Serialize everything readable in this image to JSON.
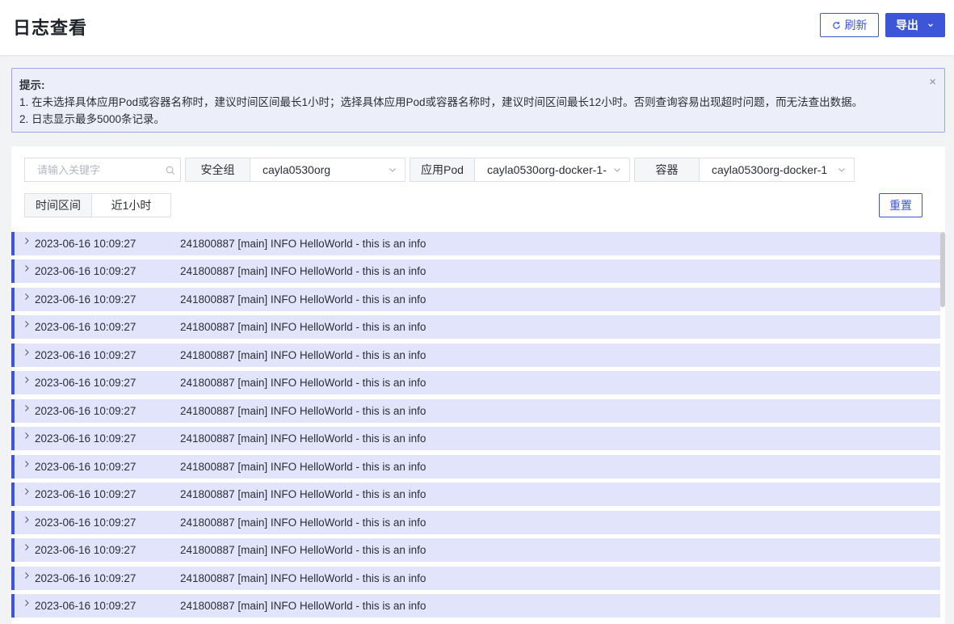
{
  "header": {
    "title": "日志查看",
    "refresh_label": "刷新",
    "export_label": "导出"
  },
  "tip": {
    "title": "提示:",
    "line1": "1. 在未选择具体应用Pod或容器名称时，建议时间区间最长1小时；选择具体应用Pod或容器名称时，建议时间区间最长12小时。否则查询容易出现超时问题，而无法查出数据。",
    "line2": "2. 日志显示最多5000条记录。",
    "close_glyph": "×"
  },
  "filters": {
    "search_placeholder": "请输入关键字",
    "security_group_label": "安全组",
    "security_group_value": "cayla0530org",
    "pod_label": "应用Pod",
    "pod_value": "cayla0530org-docker-1-",
    "container_label": "容器",
    "container_value": "cayla0530org-docker-1",
    "time_label": "时间区间",
    "time_value": "近1小时",
    "reset_label": "重置"
  },
  "logs": [
    {
      "ts": "2023-06-16 10:09:27",
      "msg": "241800887 [main] INFO HelloWorld - this is an info"
    },
    {
      "ts": "2023-06-16 10:09:27",
      "msg": "241800887 [main] INFO HelloWorld - this is an info"
    },
    {
      "ts": "2023-06-16 10:09:27",
      "msg": "241800887 [main] INFO HelloWorld - this is an info"
    },
    {
      "ts": "2023-06-16 10:09:27",
      "msg": "241800887 [main] INFO HelloWorld - this is an info"
    },
    {
      "ts": "2023-06-16 10:09:27",
      "msg": "241800887 [main] INFO HelloWorld - this is an info"
    },
    {
      "ts": "2023-06-16 10:09:27",
      "msg": "241800887 [main] INFO HelloWorld - this is an info"
    },
    {
      "ts": "2023-06-16 10:09:27",
      "msg": "241800887 [main] INFO HelloWorld - this is an info"
    },
    {
      "ts": "2023-06-16 10:09:27",
      "msg": "241800887 [main] INFO HelloWorld - this is an info"
    },
    {
      "ts": "2023-06-16 10:09:27",
      "msg": "241800887 [main] INFO HelloWorld - this is an info"
    },
    {
      "ts": "2023-06-16 10:09:27",
      "msg": "241800887 [main] INFO HelloWorld - this is an info"
    },
    {
      "ts": "2023-06-16 10:09:27",
      "msg": "241800887 [main] INFO HelloWorld - this is an info"
    },
    {
      "ts": "2023-06-16 10:09:27",
      "msg": "241800887 [main] INFO HelloWorld - this is an info"
    },
    {
      "ts": "2023-06-16 10:09:27",
      "msg": "241800887 [main] INFO HelloWorld - this is an info"
    },
    {
      "ts": "2023-06-16 10:09:27",
      "msg": "241800887 [main] INFO HelloWorld - this is an info"
    }
  ],
  "colors": {
    "accent": "#3c55d9",
    "row_bg": "#e1e4fa",
    "tip_bg": "#eceef9",
    "tip_border": "#9aa4e6"
  },
  "icons": {
    "refresh": "refresh-icon",
    "export_dropdown": "chevron-down-icon",
    "search": "search-icon",
    "select_arrow": "chevron-down-icon",
    "expand_row": "chevron-right-icon",
    "close": "close-icon"
  }
}
